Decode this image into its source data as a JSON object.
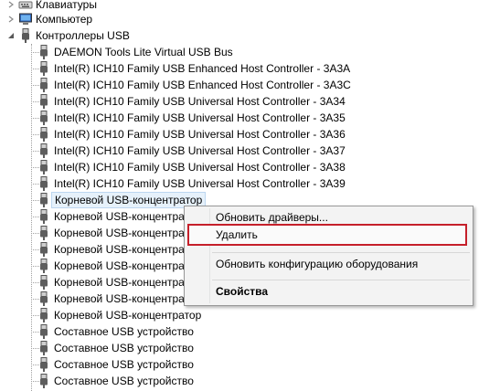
{
  "tree": {
    "keyboards": "Клавиатуры",
    "computer": "Компьютер",
    "usb_controllers": "Контроллеры USB",
    "usb_items": [
      "DAEMON Tools Lite Virtual USB Bus",
      "Intel(R) ICH10 Family USB Enhanced Host Controller - 3A3A",
      "Intel(R) ICH10 Family USB Enhanced Host Controller - 3A3C",
      "Intel(R) ICH10 Family USB Universal Host Controller - 3A34",
      "Intel(R) ICH10 Family USB Universal Host Controller - 3A35",
      "Intel(R) ICH10 Family USB Universal Host Controller - 3A36",
      "Intel(R) ICH10 Family USB Universal Host Controller - 3A37",
      "Intel(R) ICH10 Family USB Universal Host Controller - 3A38",
      "Intel(R) ICH10 Family USB Universal Host Controller - 3A39",
      "Корневой USB-концентратор",
      "Корневой USB-концентратор",
      "Корневой USB-концентратор",
      "Корневой USB-концентратор",
      "Корневой USB-концентратор",
      "Корневой USB-концентратор",
      "Корневой USB-концентратор",
      "Корневой USB-концентратор",
      "Составное USB устройство",
      "Составное USB устройство",
      "Составное USB устройство",
      "Составное USB устройство"
    ]
  },
  "context_menu": {
    "update_drivers": "Обновить драйверы...",
    "uninstall": "Удалить",
    "scan_hardware": "Обновить конфигурацию оборудования",
    "properties": "Свойства"
  },
  "colors": {
    "highlight_border": "#c51f2a",
    "selection_bg": "#e6f1fb"
  },
  "icons": {
    "keyboards": "keyboard-icon",
    "computer": "computer-icon",
    "usb": "usb-plug-icon"
  }
}
